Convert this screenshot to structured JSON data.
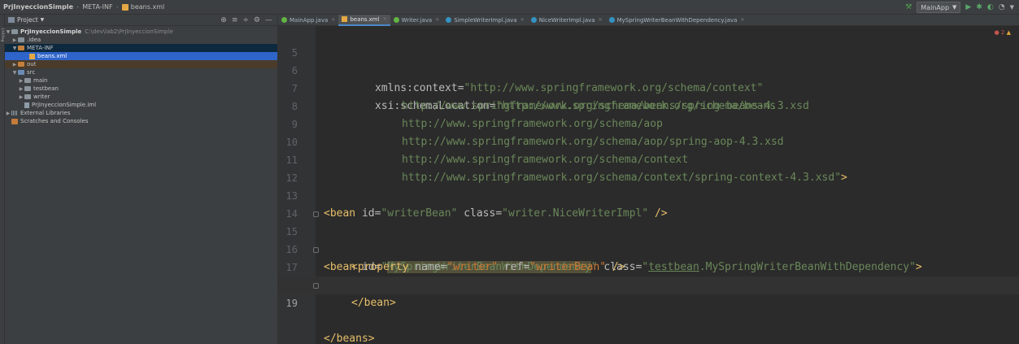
{
  "navbar": {
    "project": "PrjInyeccionSimple",
    "folder": "META-INF",
    "file": "beans.xml",
    "run_config": "MainApp"
  },
  "toolstrip": {
    "label": "Project"
  },
  "project_panel": {
    "title": "Project",
    "tree": [
      {
        "label": "PrjInyeccionSimple",
        "path": "C:\\dev\\lab2\\PrjInyeccionSimple"
      },
      {
        "label": ".idea"
      },
      {
        "label": "META-INF"
      },
      {
        "label": "beans.xml"
      },
      {
        "label": "out"
      },
      {
        "label": "src"
      },
      {
        "label": "main"
      },
      {
        "label": "testbean"
      },
      {
        "label": "writer"
      },
      {
        "label": "PrjInyeccionSimple.iml"
      },
      {
        "label": "External Libraries"
      },
      {
        "label": "Scratches and Consoles"
      }
    ]
  },
  "tabs": [
    {
      "label": "MainApp.java"
    },
    {
      "label": "beans.xml"
    },
    {
      "label": "Writer.java"
    },
    {
      "label": "SimpleWriterImpl.java"
    },
    {
      "label": "NiceWriterImpl.java"
    },
    {
      "label": "MySpringWriterBeanWithDependency.java"
    }
  ],
  "editor": {
    "problems": {
      "errors": "2",
      "warnings": "▲"
    },
    "lines": [
      {
        "n": "5"
      },
      {
        "n": "6"
      },
      {
        "n": "7"
      },
      {
        "n": "8"
      },
      {
        "n": "9"
      },
      {
        "n": "10"
      },
      {
        "n": "11"
      },
      {
        "n": "12"
      },
      {
        "n": "13"
      },
      {
        "n": "14"
      },
      {
        "n": "15"
      },
      {
        "n": "16"
      },
      {
        "n": "17"
      },
      {
        "n": "18"
      },
      {
        "n": "19"
      }
    ],
    "code": {
      "l5_attr": "xmlns:context=",
      "l5_val": "\"http://www.springframework.org/schema/context\"",
      "l6_attr": "xsi:schemaLocation=",
      "l6_val": "\"http://www.springframework.org/schema/beans",
      "l7": "http://www.springframework.org/schema/beans/spring-beans-4.3.xsd",
      "l8": "http://www.springframework.org/schema/aop",
      "l9": "http://www.springframework.org/schema/aop/spring-aop-4.3.xsd",
      "l10": "http://www.springframework.org/schema/context",
      "l11": "http://www.springframework.org/schema/context/spring-context-4.3.xsd\"",
      "l11_end": ">",
      "l13_tag": "<bean",
      "l13_id_attr": " id=",
      "l13_id_val": "\"writerBean\"",
      "l13_cls_attr": " class=",
      "l13_cls_val": "\"writer.NiceWriterImpl\"",
      "l13_end": " />",
      "l15_tag": "<bean",
      "l15_id_attr": " id=",
      "l15_q1": "\"",
      "l15_id_val": "MySpringWriterBeanWithDependency",
      "l15_q2": "\"",
      "l15_cls_attr": " class=",
      "l15_cls_q": "\"",
      "l15_cls_pkg": "testbean",
      "l15_cls_rest": ".MySpringWriterBeanWithDependency\"",
      "l15_end": ">",
      "l16_tag": "<property",
      "l16_name_attr": " name=",
      "l16_name_val": "\"writer\"",
      "l16_ref_attr": " ref=",
      "l16_ref_val": "\"writerBean\"",
      "l16_end": " />",
      "l17": "</bean>",
      "l19": "</beans>"
    }
  },
  "colors": {
    "tag": "#e8bf6a",
    "attribute": "#bababa",
    "string": "#6a8759",
    "highlight": "#52503a",
    "accent": "#4a88c7"
  }
}
